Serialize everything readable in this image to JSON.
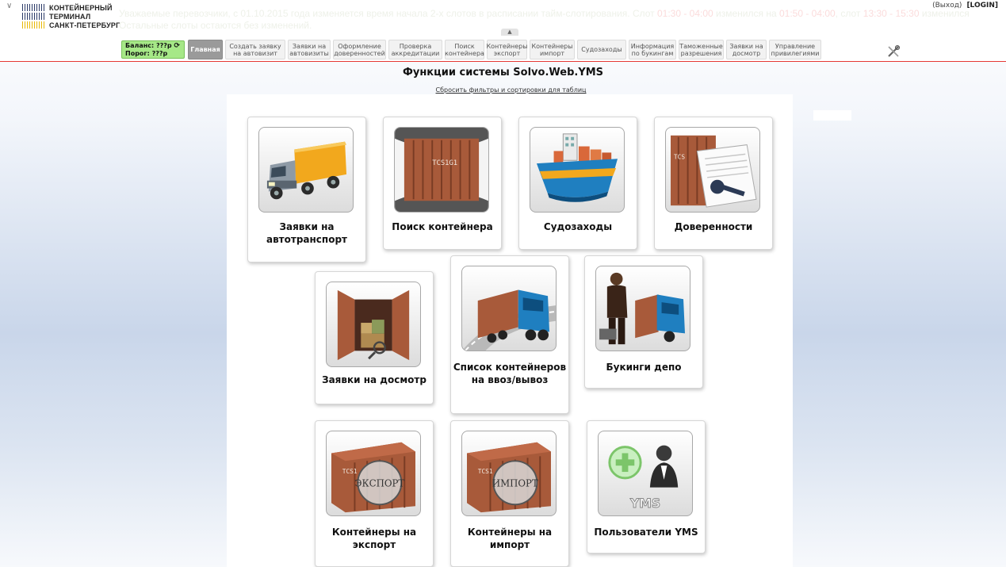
{
  "header": {
    "logo_lines": [
      "КОНТЕЙНЕРНЫЙ",
      "ТЕРМИНАЛ",
      "САНКТ-ПЕТЕРБУРГ"
    ],
    "ticker_line1_a": "Уважаемые перевозчики, с 01.10.2015 года изменяется время начала 2-х слотов в расписании тайм-слотирования. Слот ",
    "ticker_line1_b": "01:30 - 04:00",
    "ticker_line1_c": " изменился на ",
    "ticker_line1_d": "01:50 - 04:00",
    "ticker_line1_e": ", слот ",
    "ticker_line1_f": "13:30 - 15:30",
    "ticker_line1_g": " изменился",
    "ticker_line2": "Остальные слоты остаются без изменений.",
    "user_status": "(Выход)",
    "user_login": "[LOGIN]",
    "collapse_glyph": "▲",
    "balance_line1": "Баланс: ???р",
    "balance_line2": "Порог: ???р",
    "refresh_glyph": "⟳"
  },
  "nav": [
    {
      "label": "Главная"
    },
    {
      "label": "Создать заявку на автовизит"
    },
    {
      "label": "Заявки на автовизиты"
    },
    {
      "label": "Оформление доверенностей"
    },
    {
      "label": "Проверка аккредитации"
    },
    {
      "label": "Поиск контейнера"
    },
    {
      "label": "Контейнеры экспорт"
    },
    {
      "label": "Контейнеры импорт"
    },
    {
      "label": "Судозаходы"
    },
    {
      "label": "Информация по букингам"
    },
    {
      "label": "Таможенные разрешения"
    },
    {
      "label": "Заявки на досмотр"
    },
    {
      "label": "Управление привилегиями"
    }
  ],
  "main": {
    "title": "Функции системы Solvo.Web.YMS",
    "reset_link": "Сбросить фильтры и сортировки для таблиц",
    "tiles": [
      {
        "label": "Заявки на автотранспорт",
        "icon": "truck-icon"
      },
      {
        "label": "Поиск контейнера",
        "icon": "container-search-icon",
        "container_code": "TCS1G1"
      },
      {
        "label": "Судозаходы",
        "icon": "ship-icon"
      },
      {
        "label": "Доверенности",
        "icon": "power-of-attorney-icon",
        "container_code": "TCS"
      },
      {
        "label": "Заявки на досмотр",
        "icon": "inspection-icon"
      },
      {
        "label": "Список контейнеров на ввоз/вывоз",
        "icon": "container-truck-icon"
      },
      {
        "label": "Букинги депо",
        "icon": "depot-booking-icon"
      },
      {
        "label": "Контейнеры на экспорт",
        "icon": "export-container-icon",
        "stamp": "ЭКСПОРТ",
        "container_code": "TCS1"
      },
      {
        "label": "Контейнеры на импорт",
        "icon": "import-container-icon",
        "stamp": "ИМПОРТ",
        "container_code": "TCS1"
      },
      {
        "label": "Пользователи YMS",
        "icon": "yms-users-icon",
        "badge": "YMS"
      }
    ]
  },
  "colors": {
    "accent_red": "#e53935",
    "balance_green": "#a6e887",
    "container_brown": "#a85a3a",
    "truck_yellow": "#f2a81d",
    "cab_blue": "#1f7fc0"
  }
}
